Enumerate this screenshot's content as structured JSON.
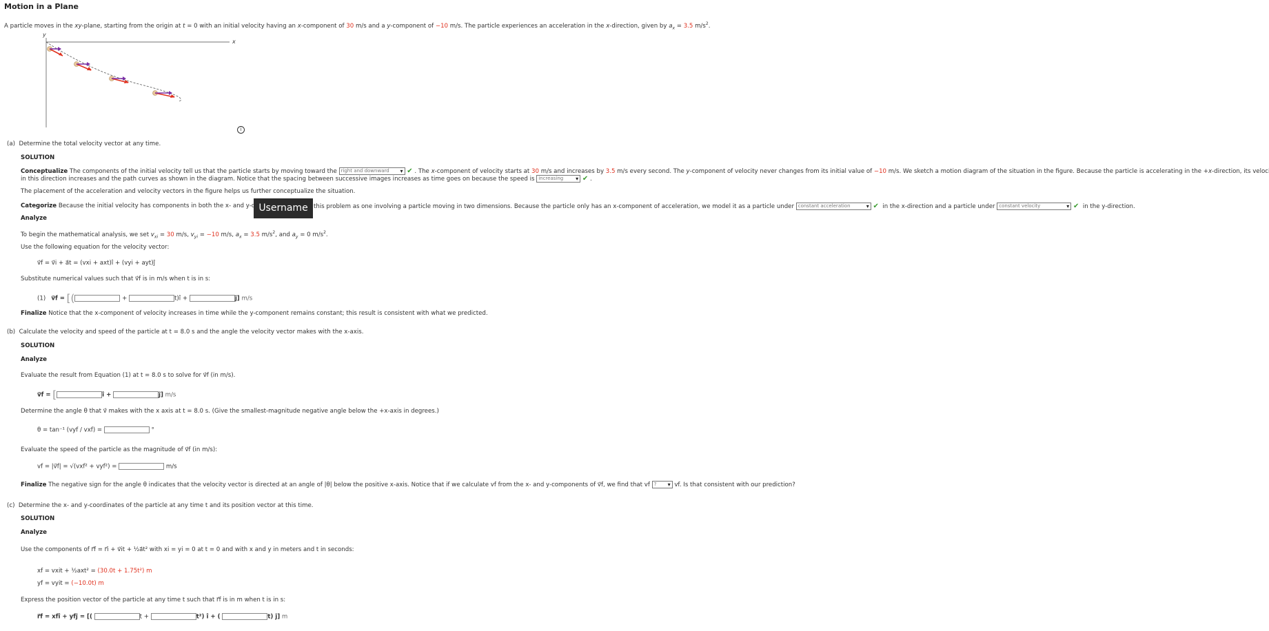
{
  "page": {
    "title": "Motion in a Plane",
    "intro": "A particle moves in the xy-plane, starting from the origin at t = 0 with an initial velocity having an x-component of 30 m/s and a y-component of −10 m/s. The particle experiences an acceleration in the x-direction, given by aₓ = 3.5 m/s².",
    "figure": {
      "axis_x": "x",
      "axis_y": "y"
    },
    "info_icon": "info-icon"
  },
  "part_a": {
    "label": "(a)",
    "question": "Determine the total velocity vector at any time.",
    "solution": "SOLUTION",
    "conceptualize_label": "Conceptualize",
    "conceptualize_1": "The components of the initial velocity tell us that the particle starts by moving toward the",
    "dropdown_direction": "right and downward",
    "conceptualize_2": ". The x-component of velocity starts at 30 m/s and increases by 3.5 m/s every second. The y-component of velocity never changes from its initial value of −10 m/s. We sketch a motion diagram of the situation in the figure. Because the particle is accelerating in the +x-direction, its velocity component",
    "conceptualize_3": "in this direction increases and the path curves as shown in the diagram. Notice that the spacing between successive images increases as time goes on because the speed is",
    "dropdown_speed": "increasing",
    "placement_text": "The placement of the acceleration and velocity vectors in the figure helps us further conceptualize the situation.",
    "categorize_label": "Categorize",
    "categorize_1": "Because the initial velocity has components in both the x- and y-direc",
    "categorize_2": "this problem as one involving a particle moving in two dimensions. Because the particle only has an x-component of acceleration, we model it as a particle under",
    "dropdown_model_x": "constant acceleration",
    "categorize_3": "in the x-direction and a particle under",
    "dropdown_model_y": "constant velocity",
    "categorize_4": "in the y-direction.",
    "tooltip": "Username",
    "analyze_label": "Analyze",
    "math_begin": "To begin the mathematical analysis, we set vₓᵢ = 30 m/s, vᵧᵢ = −10 m/s, aₓ = 3.5 m/s², and aᵧ = 0 m/s².",
    "use_eq": "Use the following equation for the velocity vector:",
    "eq_velocity": "v⃗f = v⃗i + a⃗t = (vxi + axt)î + (vyi + ayt)ĵ",
    "substitute": "Substitute numerical values such that v⃗f is in m/s when t is in s:",
    "eq1_label": "(1)",
    "eq1_lhs": "v⃗f =",
    "eq1_plus": "+",
    "eq1_t_i": "t)î +",
    "eq1_j": "ĵ]",
    "eq1_unit": "m/s",
    "finalize_label": "Finalize",
    "finalize_text": "Notice that the x-component of velocity increases in time while the y-component remains constant; this result is consistent with what we predicted."
  },
  "part_b": {
    "label": "(b)",
    "question": "Calculate the velocity and speed of the particle at t = 8.0 s and the angle the velocity vector makes with the x-axis.",
    "solution": "SOLUTION",
    "analyze_label": "Analyze",
    "evaluate": "Evaluate the result from Equation (1) at t = 8.0 s to solve for v⃗f (in m/s).",
    "vf_lhs": "v⃗f =",
    "vf_i": "î +",
    "vf_j": "ĵ]",
    "vf_unit": "m/s",
    "angle_text": "Determine the angle θ that v⃗ makes with the x axis at t = 8.0 s. (Give the smallest-magnitude negative angle below the +x-axis in degrees.)",
    "theta_eq": "θ = tan⁻¹ (vyf / vxf) =",
    "theta_unit": "°",
    "speed_text": "Evaluate the speed of the particle as the magnitude of v⃗f (in m/s):",
    "speed_eq": "vf = |v⃗f| = √(vxf² + vyf²) =",
    "speed_unit": "m/s",
    "finalize_label": "Finalize",
    "finalize_1": "The negative sign for the angle θ indicates that the velocity vector is directed at an angle of |θ| below the positive x-axis. Notice that if we calculate vf from the x- and y-components of v⃗f, we find that vf",
    "dropdown_compare": "?",
    "finalize_2": "vf. Is that consistent with our prediction?"
  },
  "part_c": {
    "label": "(c)",
    "question": "Determine the x- and y-coordinates of the particle at any time t and its position vector at this time.",
    "solution": "SOLUTION",
    "analyze_label": "Analyze",
    "use_components": "Use the components of r⃗f = r⃗i + v⃗it + ½a⃗t² with xi = yi = 0 at t = 0 and with x and y in meters and t in seconds:",
    "xf_eq": "xf = vxit + ½axt² =",
    "xf_val": "(30.0t + 1.75t²) m",
    "yf_eq": "yf = vyit =",
    "yf_val": "(−10.0t) m",
    "express": "Express the position vector of the particle at any time t such that r⃗f is in m when t is in s:",
    "rf_lhs": "r⃗f = xfî + yfĵ = [(",
    "rf_t": "t +",
    "rf_t2": "t²) î + (",
    "rf_j": "t) ĵ]",
    "rf_unit": "m"
  },
  "colors": {
    "highlight": "#e0301e",
    "check": "#3a9b2f",
    "arrow_velocity": "#e0301e",
    "arrow_accel": "#7b2fa6",
    "particle": "#e9c89a"
  }
}
